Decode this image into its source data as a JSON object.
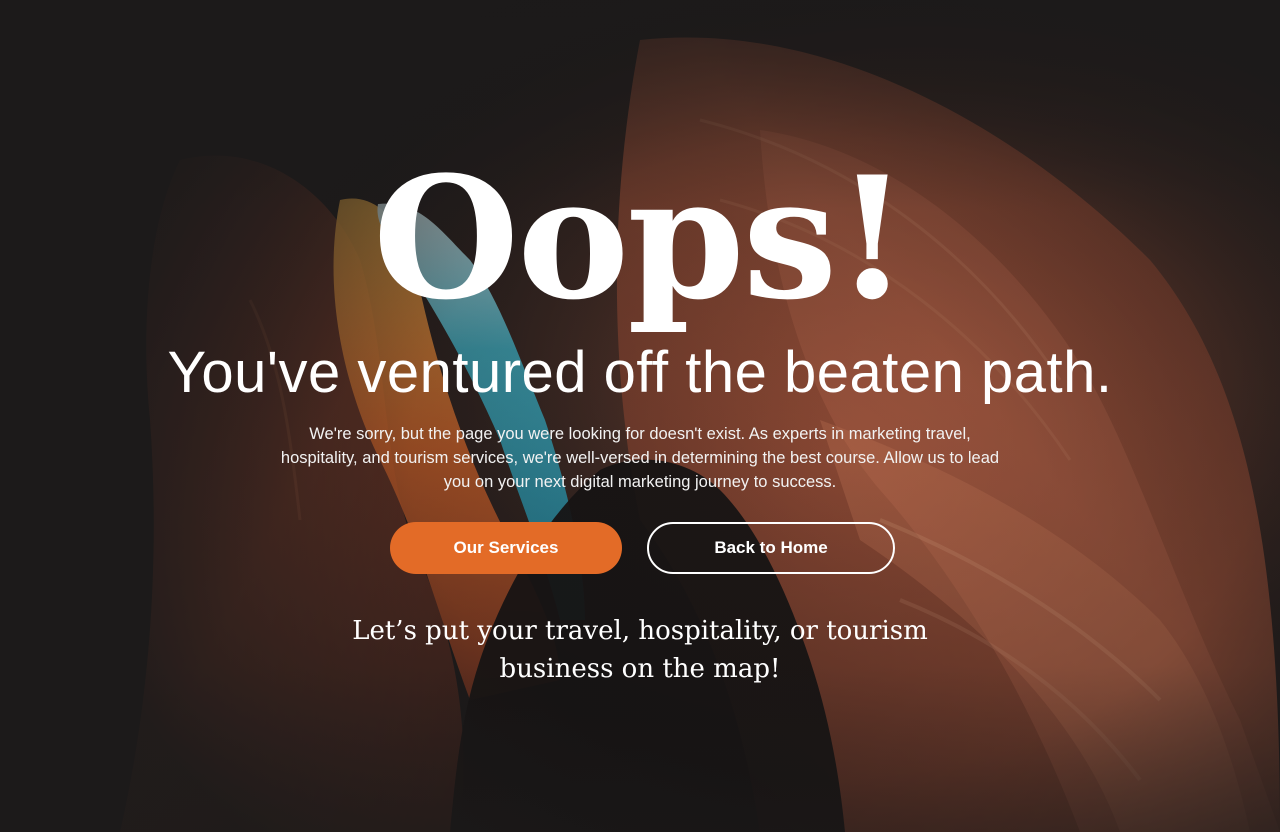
{
  "hero": {
    "heading": "Oops!",
    "subheading": "You've ventured off the beaten path.",
    "description": "We're sorry, but the page you were looking for doesn't exist. As experts in marketing travel, hospitality, and tourism services, we're well-versed in determining the best course. Allow us to lead you on your next digital marketing journey to success.",
    "tagline": "Let’s put your travel, hospitality, or tourism business on the map!"
  },
  "buttons": {
    "primary_label": "Our Services",
    "secondary_label": "Back to Home"
  },
  "colors": {
    "accent": "#e36b27",
    "background": "#1d1b1b",
    "text": "#ffffff"
  }
}
